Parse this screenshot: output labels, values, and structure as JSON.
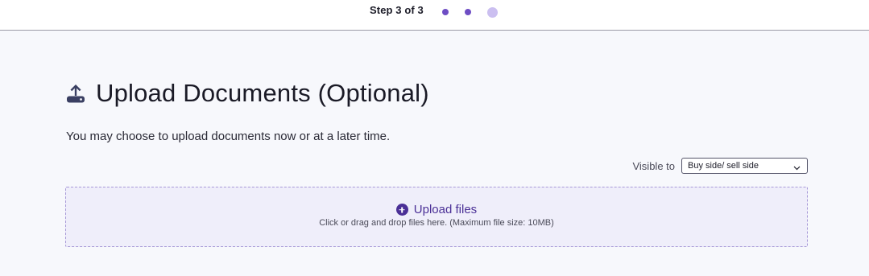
{
  "stepper": {
    "label": "Step 3 of 3",
    "steps": [
      "done",
      "done",
      "current"
    ],
    "accent_color": "#6e4dc4",
    "current_color": "#cbbff0"
  },
  "page": {
    "title": "Upload Documents (Optional)",
    "title_icon": "upload-icon",
    "subtitle": "You may choose to upload documents now or at a later time."
  },
  "visibility": {
    "label": "Visible to",
    "selected": "Buy side/ sell side"
  },
  "dropzone": {
    "button_label": "Upload files",
    "button_icon": "plus-circle-icon",
    "hint": "Click or drag and drop files here. (Maximum file size: 10MB)",
    "accent_color": "#4a2f96"
  }
}
